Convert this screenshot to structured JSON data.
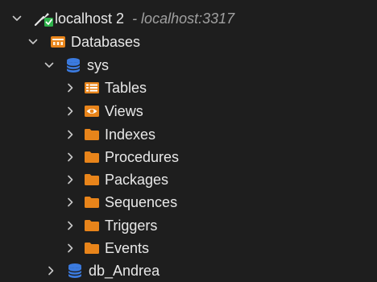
{
  "connection": {
    "name": "localhost 2",
    "address": "- localhost:3317",
    "icon": "connection-plug-icon",
    "status_color": "#2fb24b"
  },
  "databases_node": {
    "label": "Databases",
    "icon": "database-group-icon"
  },
  "schema": {
    "label": "sys",
    "icon": "database-cylinder-icon"
  },
  "children": [
    {
      "label": "Tables",
      "icon": "table-icon"
    },
    {
      "label": "Views",
      "icon": "view-eye-icon"
    },
    {
      "label": "Indexes",
      "icon": "folder-icon"
    },
    {
      "label": "Procedures",
      "icon": "folder-icon"
    },
    {
      "label": "Packages",
      "icon": "folder-icon"
    },
    {
      "label": "Sequences",
      "icon": "folder-icon"
    },
    {
      "label": "Triggers",
      "icon": "folder-icon"
    },
    {
      "label": "Events",
      "icon": "folder-icon"
    }
  ],
  "second_schema": {
    "label": "db_Andrea",
    "icon": "database-cylinder-icon"
  },
  "colors": {
    "background": "#1e1e1e",
    "folder": "#e8841a",
    "database": "#3b7be0",
    "text": "#e8e8e8",
    "muted": "#a0a0a0"
  }
}
